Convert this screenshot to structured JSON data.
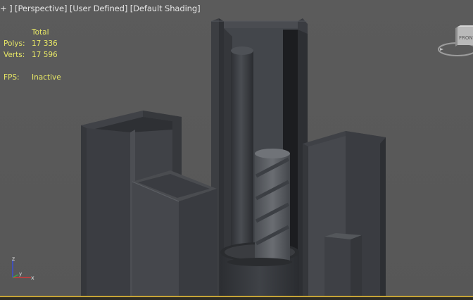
{
  "viewport": {
    "menu": {
      "plus": "+",
      "view": "Perspective",
      "shading_mode": "User Defined",
      "shading": "Default Shading"
    },
    "stats": {
      "header": "Total",
      "polys_label": "Polys:",
      "polys_value": "17 336",
      "verts_label": "Verts:",
      "verts_value": "17 596",
      "fps_label": "FPS:",
      "fps_value": "Inactive"
    },
    "viewcube": {
      "face_label": "FRONT",
      "icon": "viewcube-icon"
    },
    "axis": {
      "x": "x",
      "y": "y",
      "z": "z",
      "icon": "axis-tripod-icon"
    }
  },
  "colors": {
    "background": "#5b5b5b",
    "stats_text": "#e8e866",
    "menu_text": "#e6e6e6",
    "active_border": "#c6a437"
  }
}
